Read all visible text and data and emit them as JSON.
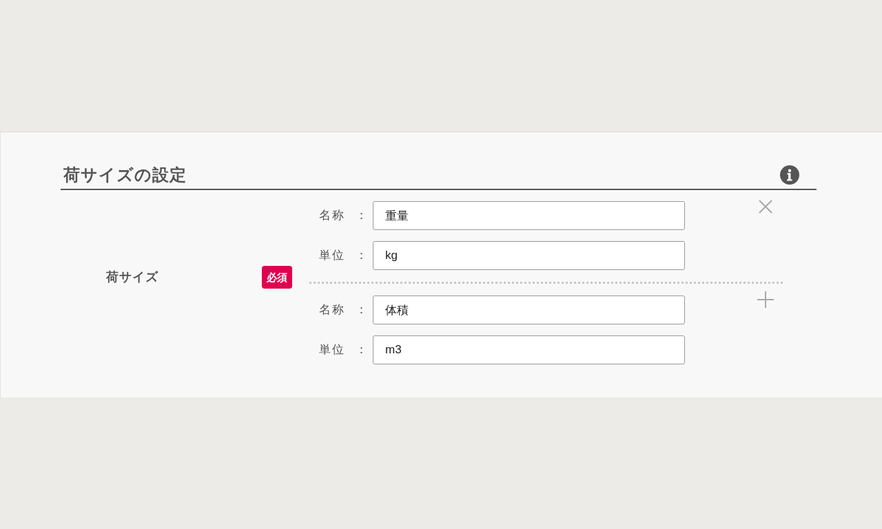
{
  "section": {
    "title": "荷サイズの設定"
  },
  "field": {
    "label": "荷サイズ",
    "badge": "必須",
    "groups": [
      {
        "kind": "remove",
        "rows": [
          {
            "label": "名称",
            "colon": "：",
            "value": "重量"
          },
          {
            "label": "単位",
            "colon": "：",
            "value": "kg"
          }
        ]
      },
      {
        "kind": "add",
        "rows": [
          {
            "label": "名称",
            "colon": "：",
            "value": "体積"
          },
          {
            "label": "単位",
            "colon": "：",
            "value": "m3"
          }
        ]
      }
    ]
  }
}
